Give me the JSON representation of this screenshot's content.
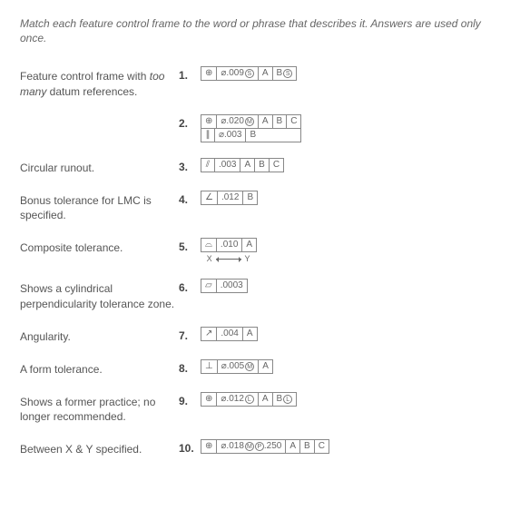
{
  "instructions": "Match each feature control frame to the word or phrase that describes it. Answers are used only once.",
  "descriptions": [
    {
      "text": "Feature control frame with ",
      "ital": "too many",
      "text2": " datum references."
    },
    {
      "text": "Circular runout."
    },
    {
      "text": "Bonus tolerance for LMC is specified."
    },
    {
      "text": "Composite tolerance."
    },
    {
      "text": "Shows a cylindrical perpendicularity tolerance zone."
    },
    {
      "text": "Angularity."
    },
    {
      "text": "A form tolerance."
    },
    {
      "text": "Shows a former practice; no longer recommended."
    },
    {
      "text": "Between X & Y specified."
    }
  ],
  "frames": {
    "1": {
      "num": "1.",
      "sym": "⊕",
      "tol": "⌀.009",
      "mods": [
        "S"
      ],
      "datums": [
        "A",
        "B"
      ],
      "datumMods": {
        "B": "S"
      }
    },
    "2": {
      "num": "2.",
      "rows": [
        {
          "sym": "⊕",
          "tol": "⌀.020",
          "mods": [
            "M"
          ],
          "datums": [
            "A",
            "B",
            "C"
          ]
        },
        {
          "sym": "∥",
          "tol": "⌀.003",
          "datums": [
            "B"
          ]
        }
      ]
    },
    "3": {
      "num": "3.",
      "sym": "⫽",
      "tol": ".003",
      "datums": [
        "A",
        "B",
        "C"
      ]
    },
    "4": {
      "num": "4.",
      "sym": "∠",
      "tol": ".012",
      "datums": [
        "B"
      ]
    },
    "5": {
      "num": "5.",
      "sym": "⌓",
      "tol": ".010",
      "datums": [
        "A"
      ],
      "below": "X ←→ Y"
    },
    "6": {
      "num": "6.",
      "sym": "▱",
      "tol": ".0003"
    },
    "7": {
      "num": "7.",
      "sym": "↗",
      "tol": ".004",
      "datums": [
        "A"
      ]
    },
    "8": {
      "num": "8.",
      "sym": "⊥",
      "tol": "⌀.005",
      "mods": [
        "M"
      ],
      "datums": [
        "A"
      ]
    },
    "9": {
      "num": "9.",
      "sym": "⊕",
      "tol": "⌀.012",
      "mods": [
        "L"
      ],
      "datums": [
        "A",
        "B"
      ],
      "datumMods": {
        "B": "L"
      }
    },
    "10": {
      "num": "10.",
      "sym": "⊕",
      "tol": "⌀.018",
      "mods": [
        "M"
      ],
      "proj": "P",
      "projVal": ".250",
      "datums": [
        "A",
        "B",
        "C"
      ]
    }
  }
}
